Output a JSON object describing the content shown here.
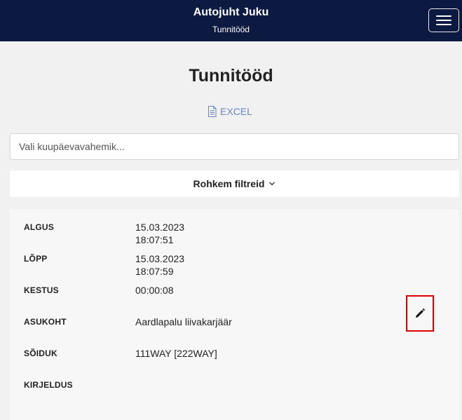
{
  "header": {
    "app_title": "Autojuht Juku",
    "subtitle": "Tunnitööd",
    "menu_icon": "hamburger-menu-icon"
  },
  "page": {
    "title": "Tunnitööd",
    "excel_label": "EXCEL",
    "excel_icon": "document-icon",
    "excel_color": "#6c86c4"
  },
  "filters": {
    "date_range_placeholder": "Vali kuupäevavahemik...",
    "date_range_value": "",
    "more_filters_label": "Rohkem filtreid",
    "more_filters_icon": "chevron-down-icon"
  },
  "record": {
    "start_label": "ALGUS",
    "start_date": "15.03.2023",
    "start_time": "18:07:51",
    "end_label": "LÕPP",
    "end_date": "15.03.2023",
    "end_time": "18:07:59",
    "duration_label": "KESTUS",
    "duration_value": "00:00:08",
    "location_label": "ASUKOHT",
    "location_value": "Aardlapalu liivakarjäär",
    "vehicle_label": "SÕIDUK",
    "vehicle_value": "111WAY [222WAY]",
    "description_label": "KIRJELDUS",
    "description_value": "",
    "edit_icon": "pencil-icon",
    "highlight_color": "#e00000"
  },
  "colors": {
    "navbar_bg": "#0c1940",
    "page_bg": "#f1f1f1"
  }
}
